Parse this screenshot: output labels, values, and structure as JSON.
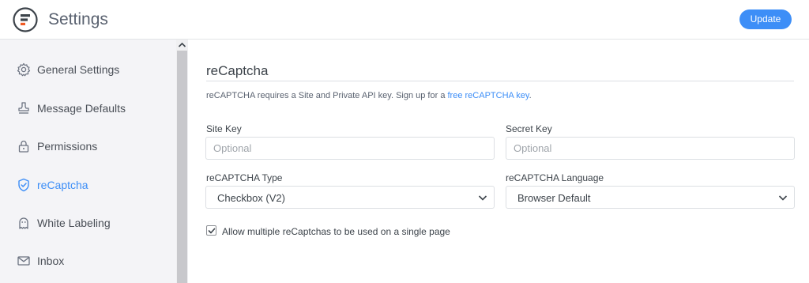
{
  "header": {
    "title": "Settings",
    "logo_icon": "formidable-logo-icon",
    "update_label": "Update"
  },
  "sidebar": {
    "items": [
      {
        "label": "General Settings",
        "icon": "gear-icon",
        "active": false
      },
      {
        "label": "Message Defaults",
        "icon": "stamp-icon",
        "active": false
      },
      {
        "label": "Permissions",
        "icon": "lock-icon",
        "active": false
      },
      {
        "label": "reCaptcha",
        "icon": "shield-check-icon",
        "active": true
      },
      {
        "label": "White Labeling",
        "icon": "ghost-icon",
        "active": false
      },
      {
        "label": "Inbox",
        "icon": "envelope-icon",
        "active": false
      }
    ]
  },
  "main": {
    "title": "reCaptcha",
    "description_prefix": "reCAPTCHA requires a Site and Private API key. Sign up for a ",
    "description_link": "free reCAPTCHA key",
    "description_suffix": ".",
    "site_key": {
      "label": "Site Key",
      "placeholder": "Optional",
      "value": ""
    },
    "secret_key": {
      "label": "Secret Key",
      "placeholder": "Optional",
      "value": ""
    },
    "type": {
      "label": "reCAPTCHA Type",
      "value": "Checkbox (V2)"
    },
    "language": {
      "label": "reCAPTCHA Language",
      "value": "Browser Default"
    },
    "multiple": {
      "label": "Allow multiple reCaptchas to be used on a single page",
      "checked": true
    }
  },
  "colors": {
    "accent": "#3d8ef7",
    "sidebar_bg": "#f4f4f7"
  }
}
